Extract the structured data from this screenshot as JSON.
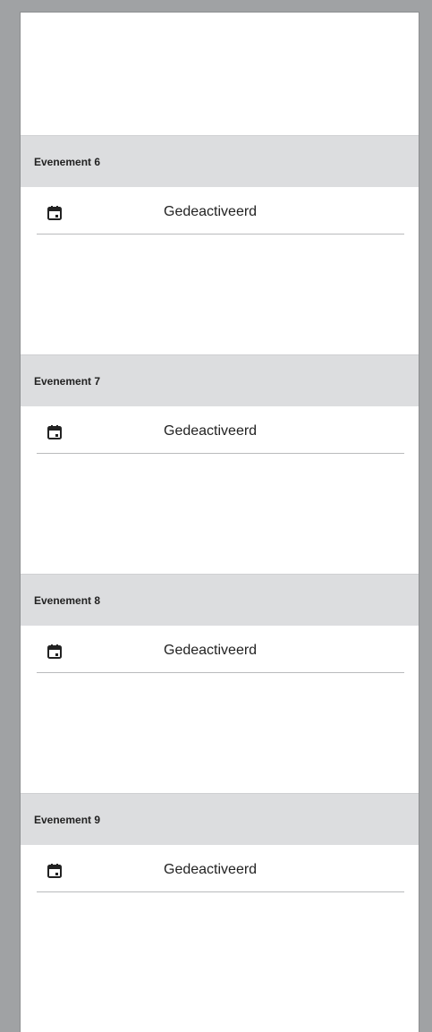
{
  "events": [
    {
      "title": "Evenement 6",
      "status": "Gedeactiveerd",
      "icon": "calendar-icon"
    },
    {
      "title": "Evenement 7",
      "status": "Gedeactiveerd",
      "icon": "calendar-icon"
    },
    {
      "title": "Evenement 8",
      "status": "Gedeactiveerd",
      "icon": "calendar-icon"
    },
    {
      "title": "Evenement 9",
      "status": "Gedeactiveerd",
      "icon": "calendar-icon"
    }
  ]
}
